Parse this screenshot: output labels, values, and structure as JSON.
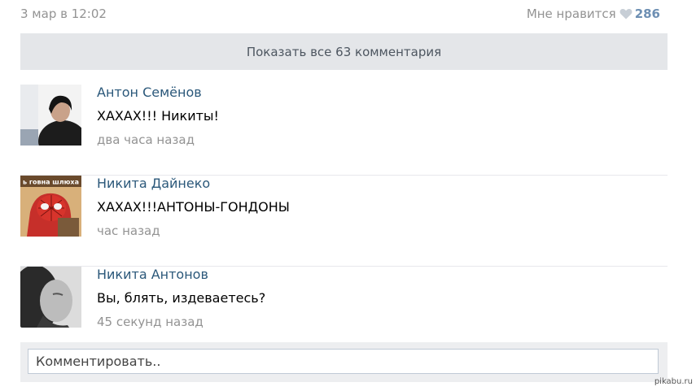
{
  "post": {
    "date": "3 мар в 12:02",
    "likes_label": "Мне нравится",
    "likes_count": "286"
  },
  "show_all": {
    "label": "Показать все 63 комментария"
  },
  "comments": [
    {
      "author": "Антон Семёнов",
      "text": "ХАХАХ!!! Никиты!",
      "time": "два часа назад"
    },
    {
      "author": "Никита Дайнеко",
      "text": "ХАХАХ!!!АНТОНЫ-ГОНДОНЫ",
      "time": "час назад",
      "avatar_caption": "ь говна шлюха"
    },
    {
      "author": "Никита Антонов",
      "text": "Вы, блять, издеваетесь?",
      "time": "45 секунд назад"
    }
  ],
  "reply": {
    "placeholder": "Комментировать.."
  },
  "watermark": "pikabu.ru",
  "colors": {
    "link": "#2b587a",
    "muted": "#939393",
    "count": "#6d8fb3",
    "bar": "#e4e6e9"
  }
}
